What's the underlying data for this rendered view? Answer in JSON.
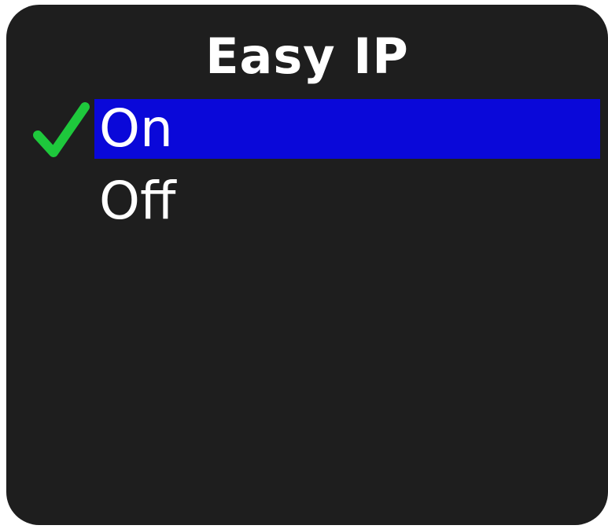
{
  "screen": {
    "title": "Easy IP",
    "options": [
      {
        "label": "On",
        "selected": true,
        "checked": true
      },
      {
        "label": "Off",
        "selected": false,
        "checked": false
      }
    ]
  },
  "colors": {
    "background": "#1e1e1e",
    "highlight": "#0a08d9",
    "check": "#1ec83c",
    "text": "#ffffff"
  },
  "icons": {
    "checked_option": "checkmark-icon"
  }
}
